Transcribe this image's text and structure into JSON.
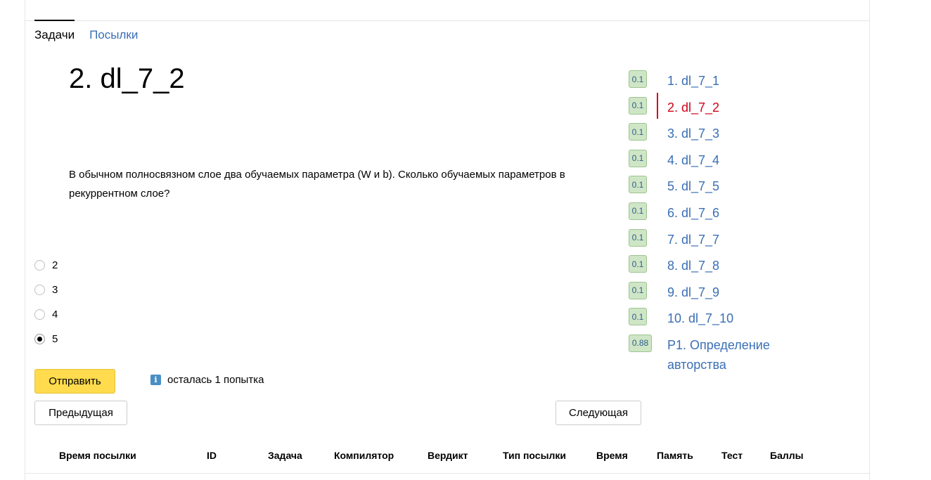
{
  "tabs": [
    {
      "label": "Задачи",
      "active": true
    },
    {
      "label": "Посылки",
      "active": false
    }
  ],
  "problem": {
    "title": "2. dl_7_2",
    "statement": "В обычном полносвязном слое два обучаемых параметра (W и b). Сколько обучаемых параметров в рекуррентном слое?"
  },
  "options": [
    {
      "label": "2",
      "checked": false
    },
    {
      "label": "3",
      "checked": false
    },
    {
      "label": "4",
      "checked": false
    },
    {
      "label": "5",
      "checked": true
    }
  ],
  "buttons": {
    "submit": "Отправить",
    "prev": "Предыдущая",
    "next": "Следующая"
  },
  "attempts": {
    "icon": "info-icon",
    "icon_glyph": "i",
    "text": "осталась 1 попытка"
  },
  "table": {
    "headers": [
      "Время посылки",
      "ID",
      "Задача",
      "Компилятор",
      "Вердикт",
      "Тип посылки",
      "Время",
      "Память",
      "Тест",
      "Баллы"
    ]
  },
  "problem_list": [
    {
      "score": "0.1",
      "label": "1. dl_7_1",
      "active": false
    },
    {
      "score": "0.1",
      "label": "2. dl_7_2",
      "active": true
    },
    {
      "score": "0.1",
      "label": "3. dl_7_3",
      "active": false
    },
    {
      "score": "0.1",
      "label": "4. dl_7_4",
      "active": false
    },
    {
      "score": "0.1",
      "label": "5. dl_7_5",
      "active": false
    },
    {
      "score": "0.1",
      "label": "6. dl_7_6",
      "active": false
    },
    {
      "score": "0.1",
      "label": "7. dl_7_7",
      "active": false
    },
    {
      "score": "0.1",
      "label": "8. dl_7_8",
      "active": false
    },
    {
      "score": "0.1",
      "label": "9. dl_7_9",
      "active": false
    },
    {
      "score": "0.1",
      "label": "10. dl_7_10",
      "active": false
    },
    {
      "score": "0.88",
      "label": "P1. Определение авторства",
      "active": false
    }
  ],
  "colors": {
    "accent_link": "#3a6fb5",
    "active_problem": "#d0021b",
    "submit_button": "#ffdb4d",
    "score_badge": "#cfe6c6"
  }
}
